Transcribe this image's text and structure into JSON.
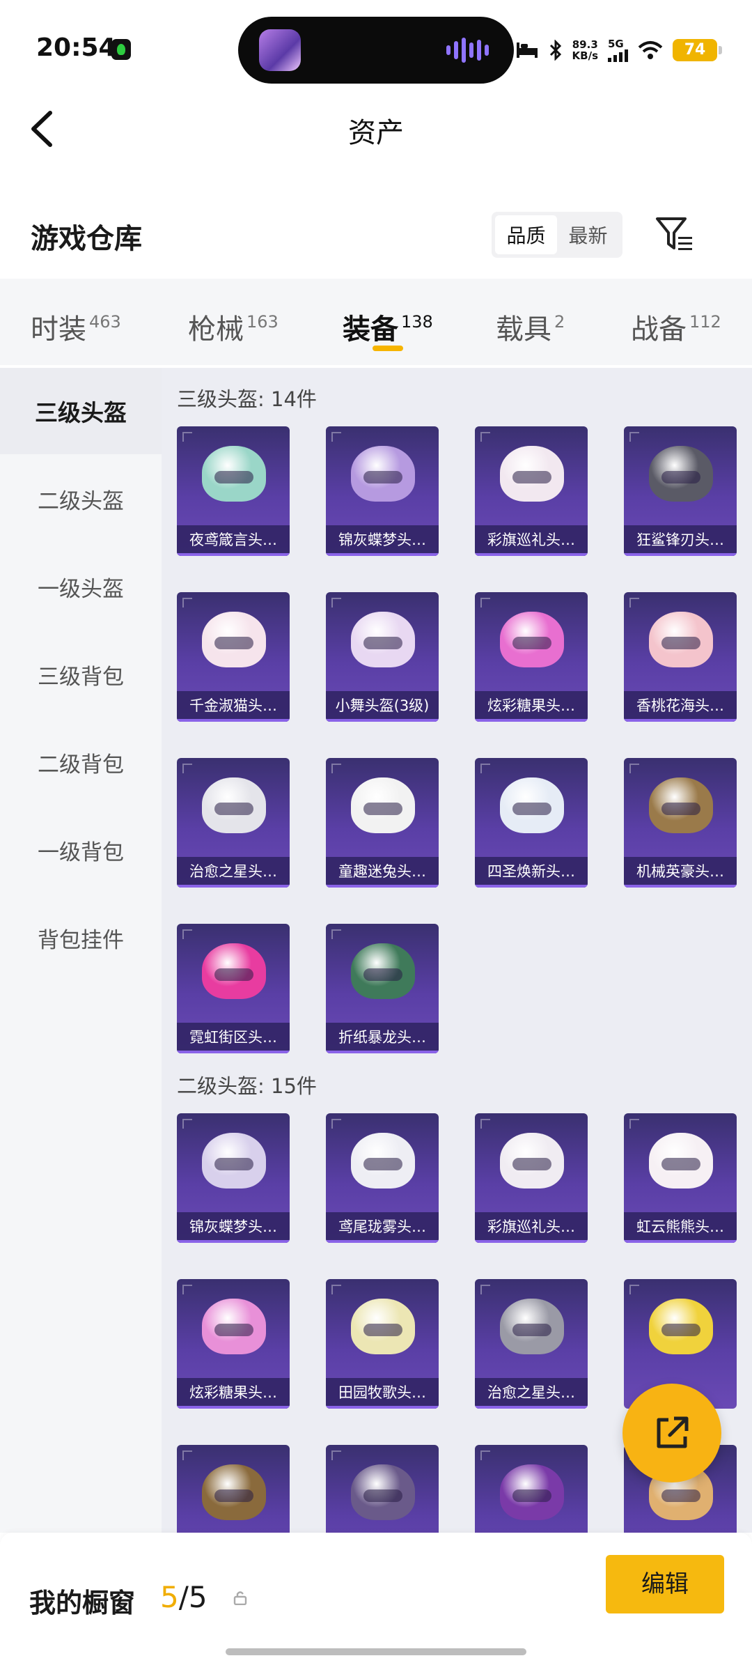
{
  "status_bar": {
    "time": "20:54",
    "net_speed_value": "89.3",
    "net_speed_unit": "KB/s",
    "network": "5G",
    "battery": "74"
  },
  "nav": {
    "title": "资产"
  },
  "warehouse": {
    "title": "游戏仓库",
    "sort_options": [
      "品质",
      "最新"
    ],
    "active_sort": "品质"
  },
  "category_tabs": [
    {
      "label": "时装",
      "count": "463"
    },
    {
      "label": "枪械",
      "count": "163"
    },
    {
      "label": "装备",
      "count": "138",
      "active": true
    },
    {
      "label": "载具",
      "count": "2"
    },
    {
      "label": "战备",
      "count": "112"
    }
  ],
  "sidebar": [
    {
      "label": "三级头盔",
      "active": true
    },
    {
      "label": "二级头盔"
    },
    {
      "label": "一级头盔"
    },
    {
      "label": "三级背包"
    },
    {
      "label": "二级背包"
    },
    {
      "label": "一级背包"
    },
    {
      "label": "背包挂件"
    }
  ],
  "groups": [
    {
      "title": "三级头盔: 14件",
      "items": [
        {
          "name": "夜鸢箴言头…",
          "color": "#9ad6c8"
        },
        {
          "name": "锦灰蝶梦头…",
          "color": "#b69ae0"
        },
        {
          "name": "彩旗巡礼头…",
          "color": "#f2e8f0"
        },
        {
          "name": "狂鲨锋刃头…",
          "color": "#5a5a66"
        },
        {
          "name": "千金淑猫头…",
          "color": "#f6e4ec"
        },
        {
          "name": "小舞头盔(3级)",
          "color": "#e8d8f2"
        },
        {
          "name": "炫彩糖果头…",
          "color": "#e86fd0"
        },
        {
          "name": "香桃花海头…",
          "color": "#f4c4cc"
        },
        {
          "name": "治愈之星头…",
          "color": "#e4e4ea"
        },
        {
          "name": "童趣迷兔头…",
          "color": "#f2f2f2"
        },
        {
          "name": "四圣焕新头…",
          "color": "#e6ecf6"
        },
        {
          "name": "机械英豪头…",
          "color": "#9a7a4a"
        },
        {
          "name": "霓虹街区头…",
          "color": "#e83ca0"
        },
        {
          "name": "折纸暴龙头…",
          "color": "#3f7a5a"
        }
      ]
    },
    {
      "title": "二级头盔: 15件",
      "items": [
        {
          "name": "锦灰蝶梦头…",
          "color": "#d8d0ec"
        },
        {
          "name": "鸢尾珑雾头…",
          "color": "#eeeef4"
        },
        {
          "name": "彩旗巡礼头…",
          "color": "#f0ecf2"
        },
        {
          "name": "虹云熊熊头…",
          "color": "#f6f0f4"
        },
        {
          "name": "炫彩糖果头…",
          "color": "#e890d8"
        },
        {
          "name": "田园牧歌头…",
          "color": "#ece6b4"
        },
        {
          "name": "治愈之星头…",
          "color": "#9a9aa6"
        },
        {
          "name": "",
          "color": "#f0d23c"
        },
        {
          "name": "",
          "color": "#8a6a3c"
        },
        {
          "name": "",
          "color": "#6a5a8a"
        },
        {
          "name": "",
          "color": "#7a3aa8"
        },
        {
          "name": "",
          "color": "#e0b070"
        }
      ]
    }
  ],
  "bottom_bar": {
    "label": "我的橱窗",
    "count_current": "5",
    "count_sep_total": "/5",
    "edit_label": "编辑"
  },
  "icons": {
    "back": "chevron-left-icon",
    "filter": "filter-icon",
    "share": "share-icon",
    "lock": "lock-icon"
  },
  "colors": {
    "accent": "#f6b90f",
    "card_bg": "#5a3fa6",
    "highlight_count": "#f0ad00"
  }
}
